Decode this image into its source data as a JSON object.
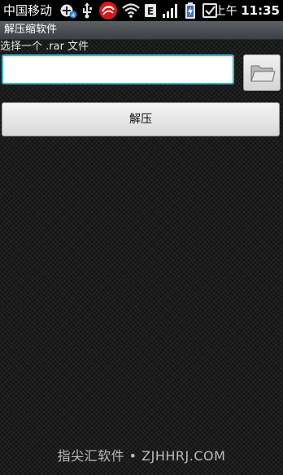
{
  "status_bar": {
    "carrier": "中国移动",
    "notification_count": "4",
    "network_type": "E",
    "ampm": "上午",
    "time": "11:35",
    "icons": [
      "add-circle-icon",
      "usb-icon",
      "antivirus-app-icon",
      "wifi-icon",
      "network-e-icon",
      "signal-icon",
      "battery-charging-icon",
      "checkbox-icon"
    ]
  },
  "title_bar": {
    "title": "解压缩软件"
  },
  "main": {
    "prompt": "选择一个 .rar 文件",
    "path_input": {
      "value": "",
      "placeholder": ""
    },
    "browse_button": {
      "icon": "folder-icon"
    },
    "extract_button": {
      "label": "解压"
    }
  },
  "watermark": {
    "text": "指尖汇软件 • ZJHHRJ.COM"
  },
  "colors": {
    "input_focus_border": "#38b7d4",
    "title_bar": "#4a4e52",
    "status_bar": "#000000"
  }
}
